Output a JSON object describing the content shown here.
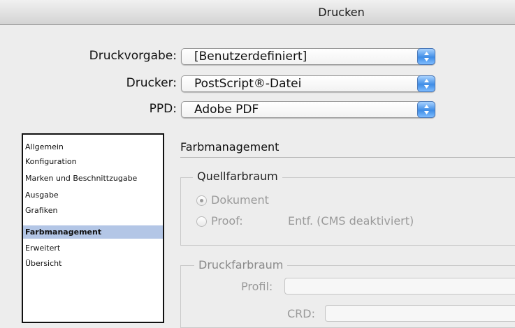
{
  "window": {
    "title": "Drucken"
  },
  "form": {
    "druckvorgabe_label": "Druckvorgabe:",
    "druckvorgabe_value": "[Benutzerdefiniert]",
    "drucker_label": "Drucker:",
    "drucker_value": "PostScript®-Datei",
    "ppd_label": "PPD:",
    "ppd_value": "Adobe PDF"
  },
  "sidebar": {
    "items": [
      {
        "label": "Allgemein"
      },
      {
        "label": "Konfiguration"
      },
      {
        "label": "Marken und Beschnittzugabe"
      },
      {
        "label": "Ausgabe"
      },
      {
        "label": "Grafiken"
      },
      {
        "label": "Farbmanagement",
        "selected": true
      },
      {
        "label": "Erweitert"
      },
      {
        "label": "Übersicht"
      }
    ]
  },
  "panel": {
    "title": "Farbmanagement",
    "quellfarbraum": {
      "title": "Quellfarbraum",
      "option_dokument": "Dokument",
      "option_proof": "Proof:",
      "proof_value": "Entf. (CMS deaktiviert)",
      "selected": "Dokument"
    },
    "druckfarbraum": {
      "title": "Druckfarbraum",
      "profil_label": "Profil:",
      "crd_label": "CRD:"
    }
  },
  "colors": {
    "selection": "#b3c6e6",
    "stepper_blue": "#3f8de6",
    "disabled_text": "#9a9a9a"
  }
}
